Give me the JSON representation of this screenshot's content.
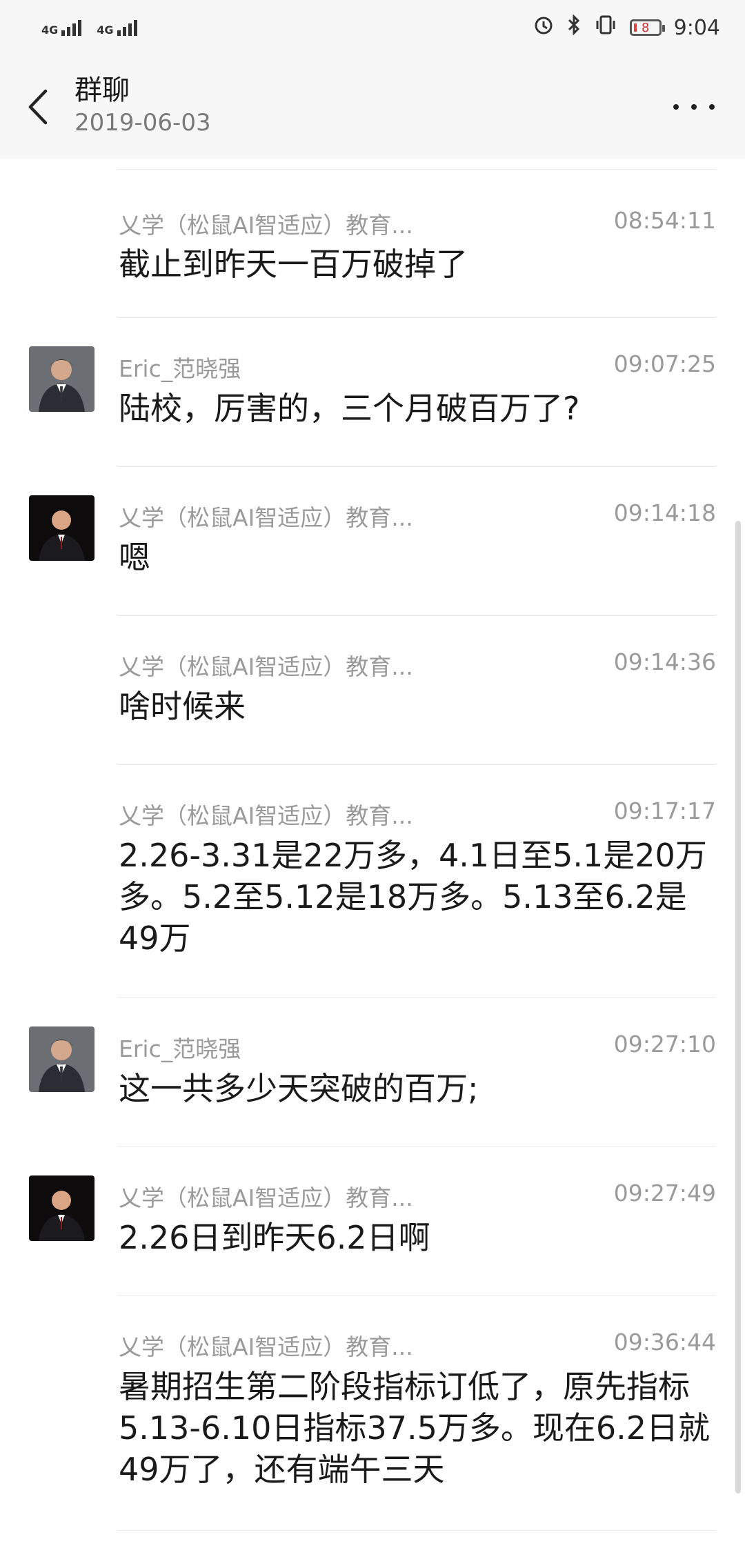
{
  "status_bar": {
    "signal1": "4G",
    "signal2": "4G",
    "battery": "8",
    "time": "9:04"
  },
  "header": {
    "title": "群聊",
    "subtitle": "2019-06-03"
  },
  "messages": [
    {
      "sender": "乂学（松鼠AI智适应）教育...",
      "time": "08:54:11",
      "text": "截止到昨天一百万破掉了",
      "avatar": "none"
    },
    {
      "sender": "Eric_范晓强",
      "time": "09:07:25",
      "text": "陆校，厉害的，三个月破百万了?",
      "avatar": "eric"
    },
    {
      "sender": "乂学（松鼠AI智适应）教育...",
      "time": "09:14:18",
      "text": "嗯",
      "avatar": "yixue"
    },
    {
      "sender": "乂学（松鼠AI智适应）教育...",
      "time": "09:14:36",
      "text": "啥时候来",
      "avatar": "none"
    },
    {
      "sender": "乂学（松鼠AI智适应）教育...",
      "time": "09:17:17",
      "text": "2.26-3.31是22万多，4.1日至5.1是20万多。5.2至5.12是18万多。5.13至6.2是49万",
      "avatar": "none"
    },
    {
      "sender": "Eric_范晓强",
      "time": "09:27:10",
      "text": "这一共多少天突破的百万;",
      "avatar": "eric"
    },
    {
      "sender": "乂学（松鼠AI智适应）教育...",
      "time": "09:27:49",
      "text": "2.26日到昨天6.2日啊",
      "avatar": "yixue"
    },
    {
      "sender": "乂学（松鼠AI智适应）教育...",
      "time": "09:36:44",
      "text": "暑期招生第二阶段指标订低了，原先指标5.13-6.10日指标37.5万多。现在6.2日就49万了，还有端午三天",
      "avatar": "none"
    }
  ]
}
